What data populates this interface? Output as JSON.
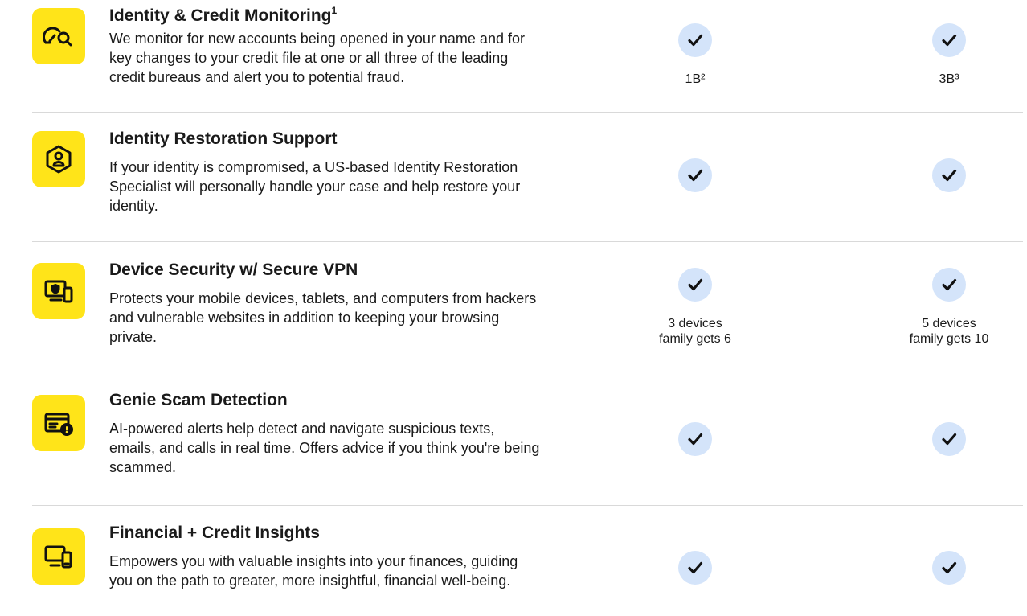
{
  "features": [
    {
      "icon": "credit-gauge-search-icon",
      "title": "Identity & Credit Monitoring",
      "title_sup": "1",
      "description": "We monitor for new accounts being opened in your name and for key changes to your credit file at one or all three of the leading credit bureaus and alert you to potential fraud.",
      "plan_a": {
        "included": true,
        "note": "1B²"
      },
      "plan_b": {
        "included": true,
        "note": "3B³"
      }
    },
    {
      "icon": "identity-hexagon-person-icon",
      "title": "Identity Restoration Support",
      "description": "If your identity is compromised, a US-based Identity Restoration Specialist will personally handle your case and help restore your identity.",
      "plan_a": {
        "included": true
      },
      "plan_b": {
        "included": true
      }
    },
    {
      "icon": "device-shield-icon",
      "title": "Device Security w/ Secure VPN",
      "description": "Protects your mobile devices, tablets, and computers from hackers and vulnerable websites in addition to keeping your browsing private.",
      "plan_a": {
        "included": true,
        "note_line1": "3 devices",
        "note_line2": "family gets 6"
      },
      "plan_b": {
        "included": true,
        "note_line1": "5 devices",
        "note_line2": "family gets 10"
      }
    },
    {
      "icon": "scam-alert-card-icon",
      "title": "Genie Scam Detection",
      "description": "AI-powered alerts help detect and navigate suspicious texts, emails, and calls in real time. Offers advice if you think you're being scammed.",
      "plan_a": {
        "included": true
      },
      "plan_b": {
        "included": true
      }
    },
    {
      "icon": "devices-icon",
      "title": "Financial + Credit Insights",
      "description": "Empowers you with valuable insights into your finances, guiding you on the path to greater, more insightful, financial well-being.",
      "plan_a": {
        "included": true
      },
      "plan_b": {
        "included": true
      }
    }
  ],
  "colors": {
    "icon_tile": "#ffe419",
    "check_circle": "#d4e4fa",
    "check_mark": "#111111",
    "divider": "#d9d9d9",
    "text": "#1a1a1a"
  }
}
